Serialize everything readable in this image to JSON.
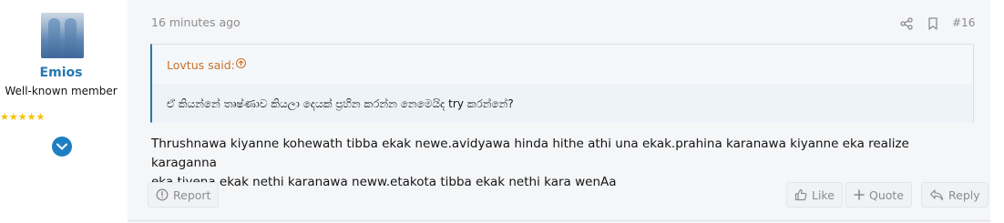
{
  "author": {
    "name": "Emios",
    "title": "Well-known member",
    "stars": "★★★★★"
  },
  "post": {
    "time": "16 minutes ago",
    "number": "#16",
    "quote": {
      "author": "Lovtus said:",
      "text": "ඒ කියන්නේ තෘෂ්ණාව කියලා දෙයක් ප්‍රහින කරන්න නෙමෙයිද try කරන්නේ?"
    },
    "message_line1": "Thrushnawa kiyanne kohewath tibba ekak newe.avidyawa hinda hithe athi una ekak.prahina karanawa kiyanne eka realize karaganna",
    "message_line2": "eka.tiyena ekak nethi karanawa neww.etakota tibba ekak nethi kara wenAa"
  },
  "actions": {
    "report": "Report",
    "like": "Like",
    "quote": "Quote",
    "reply": "Reply"
  },
  "colors": {
    "accent": "#2577b1",
    "quote_author": "#c8702a",
    "stars": "#f7c000",
    "muted": "#8c8c8c"
  },
  "icons": [
    "share-icon",
    "bookmark-icon",
    "arrow-up-circle-icon",
    "chevron-down-icon",
    "alert-circle-icon",
    "thumbs-up-icon",
    "plus-icon",
    "reply-icon"
  ]
}
